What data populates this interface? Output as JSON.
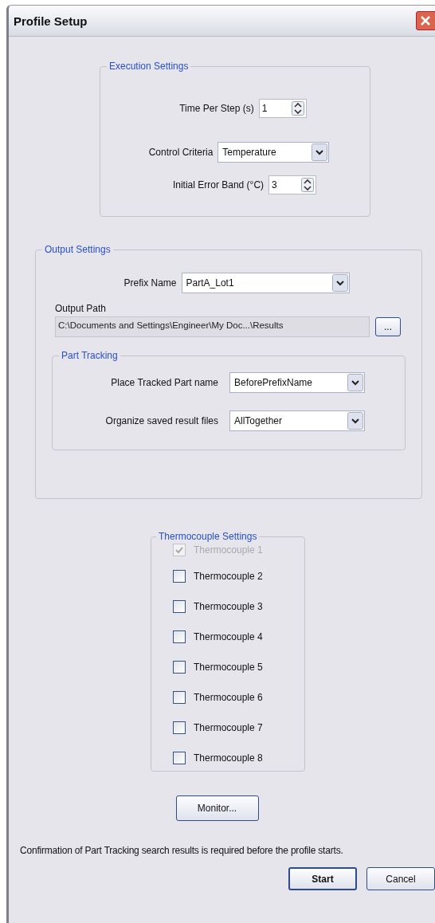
{
  "window": {
    "title": "Profile Setup"
  },
  "execution_settings": {
    "title": "Execution Settings",
    "time_per_step": {
      "label": "Time Per Step (s)",
      "value": "1"
    },
    "control_criteria": {
      "label": "Control Criteria",
      "value": "Temperature"
    },
    "initial_error_band": {
      "label": "Initial Error Band (°C)",
      "value": "3"
    }
  },
  "output_settings": {
    "title": "Output Settings",
    "prefix_name": {
      "label": "Prefix Name",
      "value": "PartA_Lot1"
    },
    "output_path": {
      "label": "Output Path",
      "value": "C:\\Documents and Settings\\Engineer\\My Doc...\\Results",
      "browse": "..."
    },
    "part_tracking": {
      "title": "Part Tracking",
      "fields": [
        {
          "label": "Place Tracked Part name",
          "value": "BeforePrefixName"
        },
        {
          "label": "Organize saved result files",
          "value": "AllTogether"
        }
      ]
    }
  },
  "thermocouple_settings": {
    "title": "Thermocouple Settings",
    "items": [
      {
        "label": "Thermocouple 1",
        "checked": true,
        "disabled": true
      },
      {
        "label": "Thermocouple 2",
        "checked": false,
        "disabled": false
      },
      {
        "label": "Thermocouple 3",
        "checked": false,
        "disabled": false
      },
      {
        "label": "Thermocouple 4",
        "checked": false,
        "disabled": false
      },
      {
        "label": "Thermocouple 5",
        "checked": false,
        "disabled": false
      },
      {
        "label": "Thermocouple 6",
        "checked": false,
        "disabled": false
      },
      {
        "label": "Thermocouple 7",
        "checked": false,
        "disabled": false
      },
      {
        "label": "Thermocouple 8",
        "checked": false,
        "disabled": false
      }
    ]
  },
  "monitor_button": "Monitor...",
  "note": "Confirmation of Part Tracking search results is required before the profile starts.",
  "buttons": [
    {
      "label": "Start",
      "default": true
    },
    {
      "label": "Cancel",
      "default": false
    }
  ]
}
